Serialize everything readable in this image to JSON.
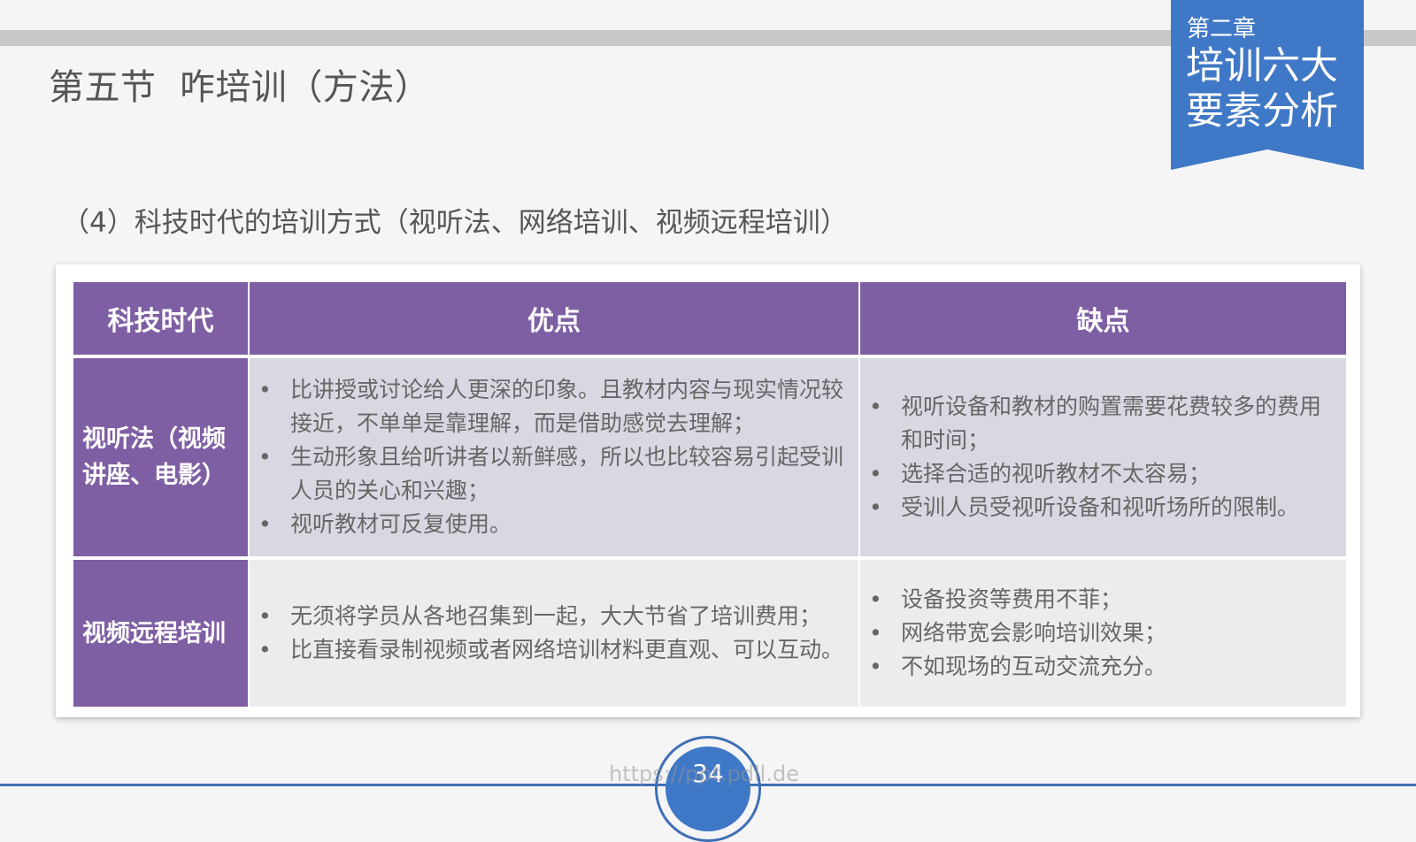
{
  "header": {
    "title": "第五节  咋培训（方法）"
  },
  "chapter": {
    "label": "第二章",
    "title": "培训六大要素分析"
  },
  "subtitle": "（4）科技时代的培训方式（视听法、网络培训、视频远程培训）",
  "table": {
    "headers": [
      "科技时代",
      "优点",
      "缺点"
    ],
    "rows": [
      {
        "label": "视听法（视频讲座、电影）",
        "pros": [
          "比讲授或讨论给人更深的印象。且教材内容与现实情况较接近，不单单是靠理解，而是借助感觉去理解；",
          "生动形象且给听讲者以新鲜感，所以也比较容易引起受训人员的关心和兴趣；",
          "视听教材可反复使用。"
        ],
        "cons": [
          "视听设备和教材的购置需要花费较多的费用和时间；",
          "选择合适的视听教材不太容易；",
          "受训人员受视听设备和视听场所的限制。"
        ]
      },
      {
        "label": "视频远程培训",
        "pros": [
          "无须将学员从各地召集到一起，大大节省了培训费用；",
          "比直接看录制视频或者网络培训材料更直观、可以互动。"
        ],
        "cons": [
          "设备投资等费用不菲；",
          "网络带宽会影响培训效果；",
          "不如现场的互动交流充分。"
        ]
      }
    ]
  },
  "footer": {
    "page_number": "34",
    "watermark": "https://ppt.pdll.de"
  },
  "colors": {
    "accent_blue": "#3f78c6",
    "table_purple": "#7f5fa3",
    "row1_bg": "#d9d7e1",
    "row2_bg": "#ececee"
  }
}
